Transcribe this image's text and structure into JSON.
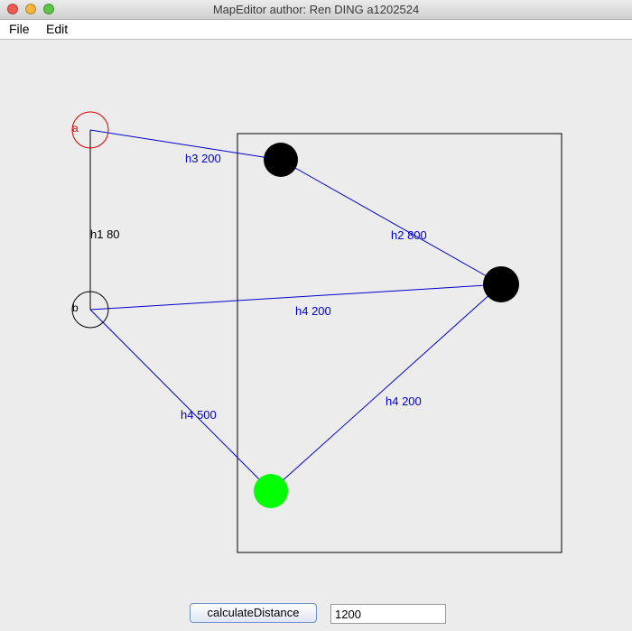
{
  "window": {
    "title": "MapEditor author: Ren DING a1202524",
    "traffic_lights": {
      "close": "#ee5b52",
      "minimize": "#f3b53d",
      "zoom": "#5ec446"
    }
  },
  "menu": {
    "items": [
      "File",
      "Edit"
    ]
  },
  "map": {
    "region_color": "#000000",
    "nodes": [
      {
        "label": "a",
        "style": "hollow",
        "color": "#e00000"
      },
      {
        "label": "b",
        "style": "hollow",
        "color": "#000000"
      },
      {
        "label": "",
        "style": "filled",
        "color": "#000000"
      },
      {
        "label": "",
        "style": "filled",
        "color": "#000000"
      },
      {
        "label": "",
        "style": "filled",
        "color": "#00ff00"
      }
    ],
    "edges": [
      {
        "label": "h1 80",
        "color": "#000000"
      },
      {
        "label": "h3 200",
        "color": "#0000cc"
      },
      {
        "label": "h2 800",
        "color": "#0000cc"
      },
      {
        "label": "h4 200",
        "color": "#0000cc"
      },
      {
        "label": "h4 500",
        "color": "#0000cc"
      },
      {
        "label": "h4 200",
        "color": "#0000cc"
      }
    ]
  },
  "controls": {
    "calculate_label": "calculateDistance",
    "distance_value": "1200"
  }
}
